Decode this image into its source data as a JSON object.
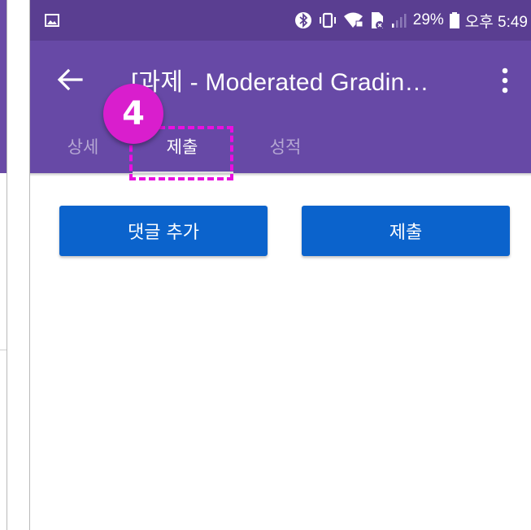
{
  "status_bar": {
    "battery_percent": "29%",
    "time": "오후 5:49",
    "icons": [
      "image-icon",
      "bluetooth-icon",
      "vibrate-icon",
      "wifi-locked-icon",
      "sim-no-signal-icon",
      "signal-icon",
      "battery-icon"
    ]
  },
  "app_bar": {
    "title": "[과제 - Moderated Gradin…",
    "back_icon": "arrow-left-icon",
    "more_icon": "more-vert-icon"
  },
  "tabs": [
    {
      "label": "상세",
      "selected": false
    },
    {
      "label": "제출",
      "selected": true
    },
    {
      "label": "성적",
      "selected": false
    }
  ],
  "annotation": {
    "step_number": "4",
    "color": "#e90fe0"
  },
  "actions": {
    "add_comment_label": "댓글 추가",
    "submit_label": "제출"
  },
  "colors": {
    "status_bar": "#5a3e91",
    "app_bar": "#6749a6",
    "button": "#0b63cc"
  }
}
